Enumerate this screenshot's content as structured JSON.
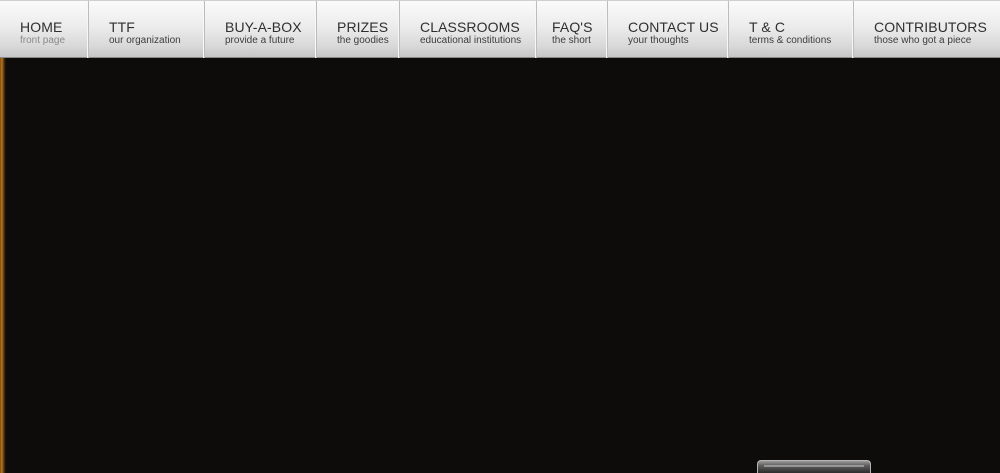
{
  "nav": {
    "items": [
      {
        "title": "HOME",
        "subtitle": "front page"
      },
      {
        "title": "TTF",
        "subtitle": "our organization"
      },
      {
        "title": "BUY-A-BOX",
        "subtitle": "provide a future"
      },
      {
        "title": "PRIZES",
        "subtitle": "the goodies"
      },
      {
        "title": "CLASSROOMS",
        "subtitle": "educational institutions"
      },
      {
        "title": "FAQ'S",
        "subtitle": "the short"
      },
      {
        "title": "CONTACT US",
        "subtitle": "your thoughts"
      },
      {
        "title": "T & C",
        "subtitle": "terms & conditions"
      },
      {
        "title": "CONTRIBUTORS",
        "subtitle": "those who got a piece"
      }
    ]
  },
  "colors": {
    "background": "#0d0c0b",
    "nav_text": "#2f2f2f",
    "edge_accent": "#b8761e"
  }
}
